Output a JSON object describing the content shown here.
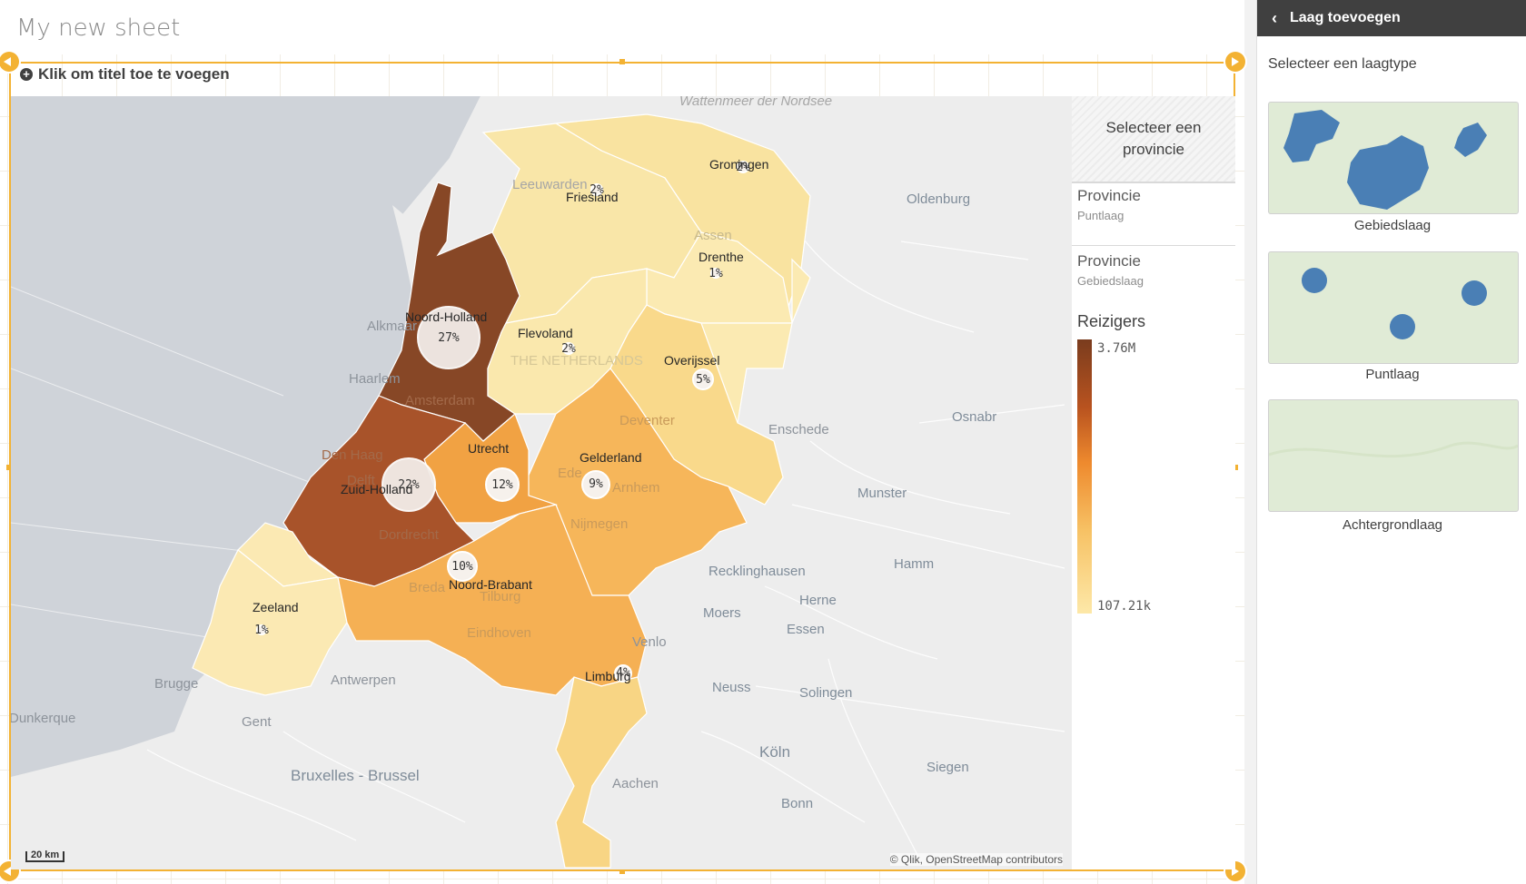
{
  "sheet": {
    "title": "My new sheet"
  },
  "object": {
    "title_prompt": "Klik om titel toe te voegen"
  },
  "map": {
    "provinces": [
      {
        "name": "Groningen",
        "pct": "2%"
      },
      {
        "name": "Friesland",
        "pct": "2%"
      },
      {
        "name": "Drenthe",
        "pct": "1%"
      },
      {
        "name": "Noord-Holland",
        "pct": "27%"
      },
      {
        "name": "Flevoland",
        "pct": "2%"
      },
      {
        "name": "Overijssel",
        "pct": "5%"
      },
      {
        "name": "Gelderland",
        "pct": "9%"
      },
      {
        "name": "Utrecht",
        "pct": "12%"
      },
      {
        "name": "Zuid-Holland",
        "pct": "22%"
      },
      {
        "name": "Zeeland",
        "pct": "1%"
      },
      {
        "name": "Noord-Brabant",
        "pct": "10%"
      },
      {
        "name": "Limburg",
        "pct": "4%"
      }
    ],
    "prov_labels": {
      "groningen": "Groningen",
      "friesland": "Friesland",
      "drenthe": "Drenthe",
      "noordholland": "Noord-Holland",
      "flevoland": "Flevoland",
      "overijssel": "Overijssel",
      "gelderland": "Gelderland",
      "utrecht": "Utrecht",
      "zuidholland": "Zuid-Holland",
      "zeeland": "Zeeland",
      "noordbrabant": "Noord-Brabant",
      "limburg": "Limburg"
    },
    "pcts": {
      "groningen": "2%",
      "friesland": "2%",
      "drenthe": "1%",
      "noordholland": "27%",
      "flevoland": "2%",
      "overijssel": "5%",
      "gelderland": "9%",
      "utrecht": "12%",
      "zuidholland": "22%",
      "zeeland": "1%",
      "noordbrabant": "10%",
      "limburg": "4%"
    },
    "places": {
      "wadden": "Wattenmeer der Nordsee",
      "leeuwarden": "Leeuwarden",
      "oldenburg": "Oldenburg",
      "assen": "Assen",
      "alkmaar": "Alkmaar",
      "haarlem": "Haarlem",
      "amsterdam": "Amsterdam",
      "netherlands": "THE NETHERLANDS",
      "deventer": "Deventer",
      "enschede": "Enschede",
      "osnabrueck": "Osnabr",
      "denhaag": "Den Haag",
      "delft": "Delft",
      "ede": "Ede",
      "arnhem": "Arnhem",
      "munster": "Munster",
      "nijmegen": "Nijmegen",
      "dordrecht": "Dordrecht",
      "breda": "Breda",
      "tilburg": "Tilburg",
      "recklinghausen": "Recklinghausen",
      "hamm": "Hamm",
      "herne": "Herne",
      "moers": "Moers",
      "essen": "Essen",
      "eindhoven": "Eindhoven",
      "venlo": "Venlo",
      "brugge": "Brugge",
      "antwerpen": "Antwerpen",
      "neuss": "Neuss",
      "solingen": "Solingen",
      "dunkerque": "Dunkerque",
      "gent": "Gent",
      "koln": "Köln",
      "siegen": "Siegen",
      "bruxelles": "Bruxelles - Brussel",
      "aachen": "Aachen",
      "bonn": "Bonn"
    },
    "scale": "20 km",
    "attribution": "© Qlik, OpenStreetMap contributors"
  },
  "legend": {
    "select_prompt_line1": "Selecteer een",
    "select_prompt_line2": "provincie",
    "layers": [
      {
        "name": "Provincie",
        "type": "Puntlaag"
      },
      {
        "name": "Provincie",
        "type": "Gebiedslaag"
      }
    ],
    "measure": "Reizigers",
    "max": "3.76M",
    "min": "107.21k"
  },
  "panel": {
    "title": "Laag toevoegen",
    "subtitle": "Selecteer een laagtype",
    "cards": [
      {
        "label": "Gebiedslaag"
      },
      {
        "label": "Puntlaag"
      },
      {
        "label": "Achtergrondlaag"
      }
    ]
  },
  "colors": {
    "accent": "#f3b233",
    "header": "#404040",
    "layer_blue": "#4a7fb5"
  }
}
